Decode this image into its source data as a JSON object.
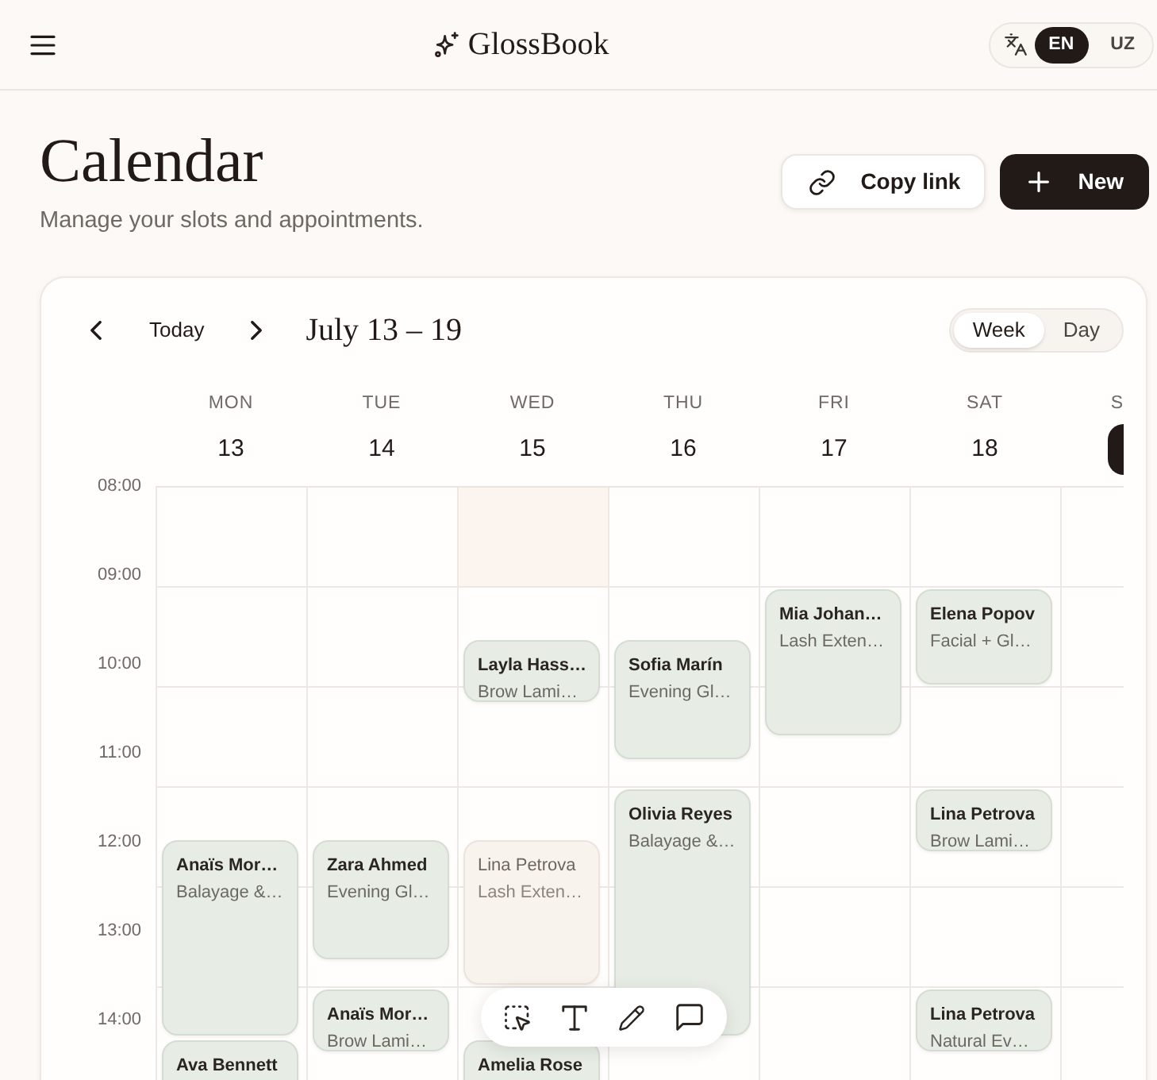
{
  "topbar": {
    "brand": "GlossBook",
    "languages": [
      {
        "label": "EN",
        "selected": true
      },
      {
        "label": "UZ",
        "selected": false
      }
    ]
  },
  "header": {
    "title": "Calendar",
    "subtitle": "Manage your slots and appointments.",
    "actions": [
      {
        "kind": "copy",
        "label": "Copy link"
      },
      {
        "kind": "create",
        "label": "New"
      }
    ]
  },
  "calendar": {
    "today_button": "Today",
    "range": "July 13 – 19",
    "views": [
      {
        "label": "Week",
        "selected": true
      },
      {
        "label": "Day",
        "selected": false
      }
    ],
    "times": [
      "08:00",
      "09:00",
      "10:00",
      "11:00",
      "12:00",
      "13:00",
      "14:00"
    ],
    "days": [
      {
        "name": "MON",
        "date": "13",
        "today": false,
        "blocked_hours": [
          false,
          false,
          false,
          false,
          false,
          false
        ],
        "events": [
          {
            "client": "Anaïs Mor…",
            "service": "Balayage &…",
            "cancelled": false
          },
          {
            "client": "Ava Bennett",
            "cancelled": false
          }
        ]
      },
      {
        "name": "TUE",
        "date": "14",
        "today": false,
        "blocked_hours": [
          false,
          false,
          false,
          false,
          false,
          false
        ],
        "events": [
          {
            "client": "Zara Ahmed",
            "service": "Evening Gl…",
            "cancelled": false
          },
          {
            "client": "Anaïs Mor…",
            "service": "Brow Lami…",
            "cancelled": false
          }
        ]
      },
      {
        "name": "WED",
        "date": "15",
        "today": false,
        "blocked_hours": [
          true,
          false,
          false,
          false,
          false,
          false
        ],
        "events": [
          {
            "client": "Layla Hass…",
            "service": "Brow Lami…",
            "cancelled": false
          },
          {
            "client": "Lina Petrova",
            "service": "Lash Exten…",
            "cancelled": true
          },
          {
            "client": "Amelia Rose",
            "cancelled": false
          }
        ]
      },
      {
        "name": "THU",
        "date": "16",
        "today": false,
        "blocked_hours": [
          false,
          false,
          false,
          false,
          false,
          false
        ],
        "events": [
          {
            "client": "Sofia Marín",
            "service": "Evening Gl…",
            "cancelled": false
          },
          {
            "client": "Olivia Reyes",
            "service": "Balayage &…",
            "cancelled": false
          }
        ]
      },
      {
        "name": "FRI",
        "date": "17",
        "today": false,
        "blocked_hours": [
          false,
          false,
          false,
          false,
          false,
          false
        ],
        "events": [
          {
            "client": "Mia Johan…",
            "service": "Lash Exten…",
            "cancelled": false
          }
        ]
      },
      {
        "name": "SAT",
        "date": "18",
        "today": false,
        "blocked_hours": [
          false,
          false,
          false,
          false,
          false,
          false
        ],
        "events": [
          {
            "client": "Elena Popov",
            "service": "Facial + Gl…",
            "cancelled": false
          },
          {
            "client": "Lina Petrova",
            "service": "Brow Lami…",
            "cancelled": false
          },
          {
            "client": "Lina Petrova",
            "service": "Natural Ev…",
            "cancelled": false
          }
        ]
      },
      {
        "name": "S",
        "today": true,
        "blocked_hours": [
          false,
          false,
          false,
          false,
          false,
          false
        ]
      }
    ]
  }
}
